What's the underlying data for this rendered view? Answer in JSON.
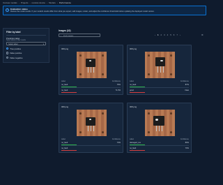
{
  "breadcrumb": [
    "Canvas models",
    "Projects",
    "resistor-device",
    "Models",
    "Performance"
  ],
  "banner": {
    "title": "Evaluation status",
    "text": "Review the model results. If your model's results differ from what you expect, add images, retrain, and adjust the confidence thresholds before updating the deployed model version."
  },
  "filter": {
    "title": "Filter by label",
    "field_label": "Prediction label",
    "field_desc": "Select labels to filter results",
    "select_placeholder": "Select label",
    "options": [
      "True positive",
      "False positive",
      "False negative"
    ],
    "selected": "True positive"
  },
  "images": {
    "header": "Images (32)",
    "search_placeholder": "Find images",
    "pages": [
      "1",
      "2",
      "3",
      "4",
      "5",
      "6",
      "7"
    ],
    "cards": [
      {
        "title": "008.png",
        "rows": [
          {
            "label": "no_fault",
            "conf": "76%",
            "status": "green"
          },
          {
            "label": "no_fault",
            "conf": "71.5%",
            "status": "red"
          }
        ]
      },
      {
        "title": "008.png",
        "rows": [
          {
            "label": "no_fault",
            "conf": "87%",
            "status": "green"
          },
          {
            "label": "good",
            "conf": "Flaw",
            "status": "red"
          }
        ]
      },
      {
        "title": "008.png",
        "rows": [
          {
            "label": "no_fault",
            "conf": "74%",
            "status": "green"
          },
          {
            "label": "no_fault",
            "conf": "",
            "status": "red"
          }
        ]
      },
      {
        "title": "008.png",
        "rows": [
          {
            "label": "damaged_res",
            "conf": "80%",
            "status": "green"
          },
          {
            "label": "no_fault",
            "conf": "70%",
            "status": "red"
          }
        ]
      }
    ],
    "col_label": "Label",
    "col_conf": "Confidence"
  },
  "colors": {
    "accent": "#0972d3",
    "background": "#0f1b2d",
    "true": "#2fb24f",
    "false": "#d63f3f"
  }
}
